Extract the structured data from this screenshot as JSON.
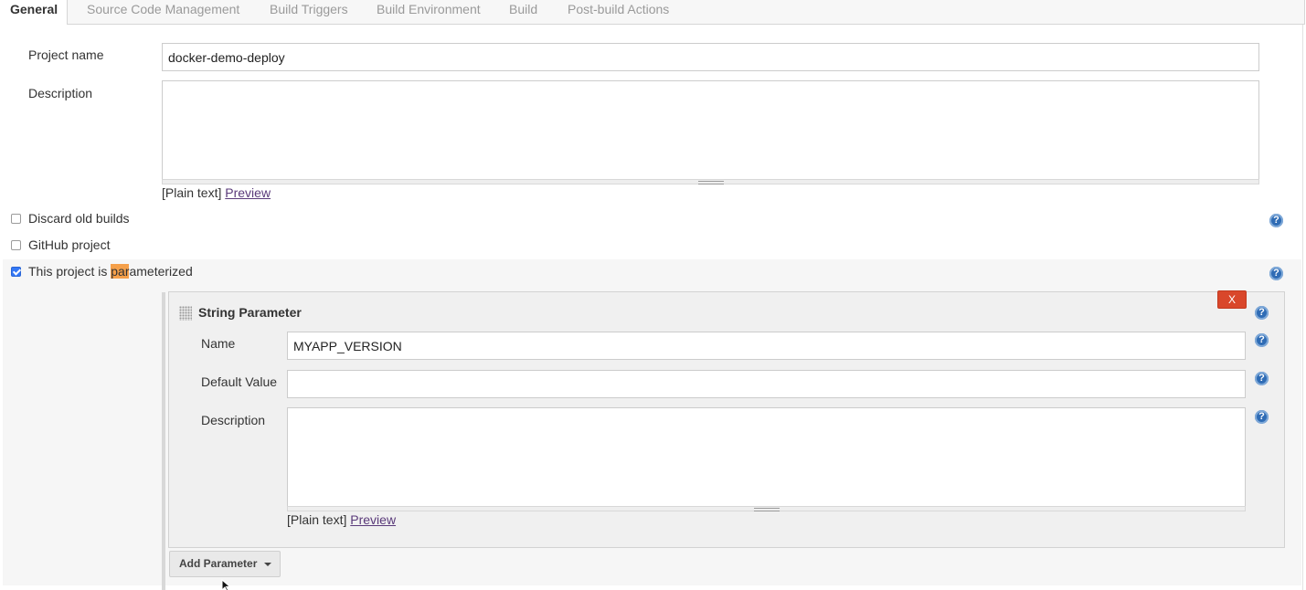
{
  "tabs": [
    {
      "label": "General",
      "active": true
    },
    {
      "label": "Source Code Management"
    },
    {
      "label": "Build Triggers"
    },
    {
      "label": "Build Environment"
    },
    {
      "label": "Build"
    },
    {
      "label": "Post-build Actions"
    }
  ],
  "general": {
    "project_name_label": "Project name",
    "project_name_value": "docker-demo-deploy",
    "description_label": "Description",
    "description_value": "",
    "format_text": "[Plain text]",
    "preview_link": "Preview"
  },
  "options": {
    "discard_old_builds": {
      "label": "Discard old builds",
      "checked": false
    },
    "github_project": {
      "label": "GitHub project",
      "checked": false
    },
    "parameterized": {
      "label_before": "This project is ",
      "label_highlight": "par",
      "label_after": "ameterized",
      "checked": true
    }
  },
  "parameter": {
    "title": "String Parameter",
    "delete_label": "X",
    "name_label": "Name",
    "name_value": "MYAPP_VERSION",
    "default_value_label": "Default Value",
    "default_value_value": "",
    "description_label": "Description",
    "description_value": "",
    "format_text": "[Plain text]",
    "preview_link": "Preview"
  },
  "add_parameter_label": "Add Parameter",
  "help_icon_glyph": "?",
  "colors": {
    "delete_button": "#d9472b",
    "highlight": "#f5a04a",
    "help_icon": "#2f6cb5",
    "link": "#5a3a7a"
  }
}
